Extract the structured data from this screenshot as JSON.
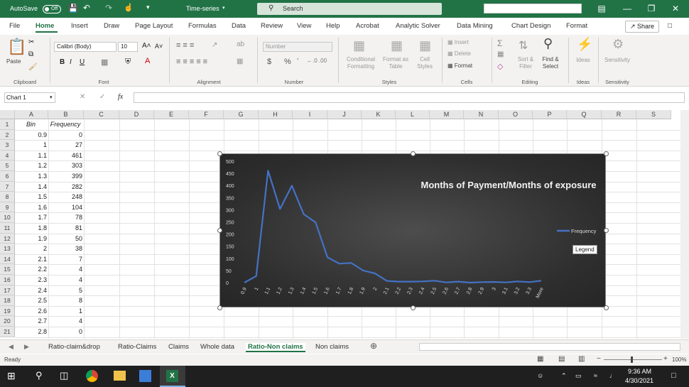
{
  "titlebar": {
    "autosave_label": "AutoSave",
    "autosave_state": "Off",
    "doc_title": "Time-series",
    "search_placeholder": "Search"
  },
  "menu_tabs": [
    "File",
    "Home",
    "Insert",
    "Draw",
    "Page Layout",
    "Formulas",
    "Data",
    "Review",
    "View",
    "Help",
    "Acrobat",
    "Analytic Solver",
    "Data Mining",
    "Chart Design",
    "Format"
  ],
  "active_tab": "Home",
  "share_label": "Share",
  "ribbon": {
    "font_name": "Calibri (Body)",
    "font_size": "10",
    "number_format": "Number",
    "paste": "Paste",
    "conditional_formatting": "Conditional Formatting",
    "format_as_table": "Format as Table",
    "cell_styles": "Cell Styles",
    "insert": "Insert",
    "delete": "Delete",
    "format": "Format",
    "sort_filter": "Sort & Filter",
    "find_select": "Find & Select",
    "ideas": "Ideas",
    "sensitivity": "Sensitivity",
    "groups": [
      "Clipboard",
      "Font",
      "Alignment",
      "Number",
      "Styles",
      "Cells",
      "Editing",
      "Ideas",
      "Sensitivity"
    ]
  },
  "formula_bar": {
    "name_box": "Chart 1",
    "fx": "fx"
  },
  "columns": [
    "A",
    "B",
    "C",
    "D",
    "E",
    "F",
    "G",
    "H",
    "I",
    "J",
    "K",
    "L",
    "M",
    "N",
    "O",
    "P",
    "Q",
    "R",
    "S"
  ],
  "rows": [
    {
      "n": "1",
      "a": "Bin",
      "b": "Frequency"
    },
    {
      "n": "2",
      "a": "0.9",
      "b": "0"
    },
    {
      "n": "3",
      "a": "1",
      "b": "27"
    },
    {
      "n": "4",
      "a": "1.1",
      "b": "461"
    },
    {
      "n": "5",
      "a": "1.2",
      "b": "303"
    },
    {
      "n": "6",
      "a": "1.3",
      "b": "399"
    },
    {
      "n": "7",
      "a": "1.4",
      "b": "282"
    },
    {
      "n": "8",
      "a": "1.5",
      "b": "248"
    },
    {
      "n": "9",
      "a": "1.6",
      "b": "104"
    },
    {
      "n": "10",
      "a": "1.7",
      "b": "78"
    },
    {
      "n": "11",
      "a": "1.8",
      "b": "81"
    },
    {
      "n": "12",
      "a": "1.9",
      "b": "50"
    },
    {
      "n": "13",
      "a": "2",
      "b": "38"
    },
    {
      "n": "14",
      "a": "2.1",
      "b": "7"
    },
    {
      "n": "15",
      "a": "2.2",
      "b": "4"
    },
    {
      "n": "16",
      "a": "2.3",
      "b": "4"
    },
    {
      "n": "17",
      "a": "2.4",
      "b": "5"
    },
    {
      "n": "18",
      "a": "2.5",
      "b": "8"
    },
    {
      "n": "19",
      "a": "2.6",
      "b": "1"
    },
    {
      "n": "20",
      "a": "2.7",
      "b": "4"
    },
    {
      "n": "21",
      "a": "2.8",
      "b": "0"
    }
  ],
  "chart_data": {
    "type": "line",
    "title": "Months of Payment/Months of exposure",
    "categories": [
      "0.9",
      "1",
      "1.1",
      "1.2",
      "1.3",
      "1.4",
      "1.5",
      "1.6",
      "1.7",
      "1.8",
      "1.9",
      "2",
      "2.1",
      "2.2",
      "2.3",
      "2.4",
      "2.5",
      "2.6",
      "2.7",
      "2.8",
      "2.9",
      "3",
      "3.1",
      "3.2",
      "3.3",
      "More"
    ],
    "series": [
      {
        "name": "Frequency",
        "values": [
          0,
          27,
          461,
          303,
          399,
          282,
          248,
          104,
          78,
          81,
          50,
          38,
          7,
          4,
          4,
          5,
          8,
          1,
          4,
          0,
          2,
          3,
          1,
          5,
          2,
          8
        ],
        "color": "#4472c4"
      }
    ],
    "ylim": [
      0,
      500
    ],
    "yticks": [
      "0",
      "50",
      "100",
      "150",
      "200",
      "250",
      "300",
      "350",
      "400",
      "450",
      "500"
    ],
    "legend_position": "right",
    "legend_tooltip": "Legend",
    "grid": false
  },
  "sheet_tabs": [
    "Ratio-claim&drop",
    "Ratio-Claims",
    "Claims",
    "Whole data",
    "Ratio-Non claims",
    "Non claims"
  ],
  "active_sheet": "Ratio-Non claims",
  "status": {
    "ready": "Ready",
    "zoom": "100%"
  },
  "taskbar": {
    "time": "9:36 AM",
    "date": "4/30/2021"
  }
}
